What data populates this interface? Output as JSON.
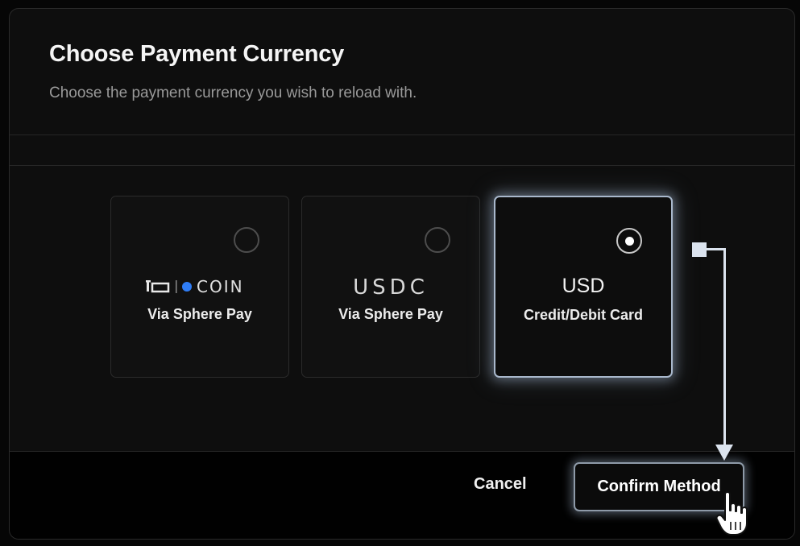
{
  "dialog": {
    "title": "Choose Payment Currency",
    "subtitle": "Choose the payment currency you wish to reload with."
  },
  "options": [
    {
      "logo_text": "COIN",
      "logo_prefix": "IO",
      "sub": "Via Sphere Pay",
      "selected": false
    },
    {
      "logo_text": "USDC",
      "sub": "Via Sphere Pay",
      "selected": false
    },
    {
      "logo_text": "USD",
      "sub": "Credit/Debit Card",
      "selected": true
    }
  ],
  "footer": {
    "cancel_label": "Cancel",
    "confirm_label": "Confirm Method"
  },
  "colors": {
    "accent_border": "#a9b8cc",
    "annotation": "#dbe3ee",
    "coin_dot": "#2f7df6"
  }
}
